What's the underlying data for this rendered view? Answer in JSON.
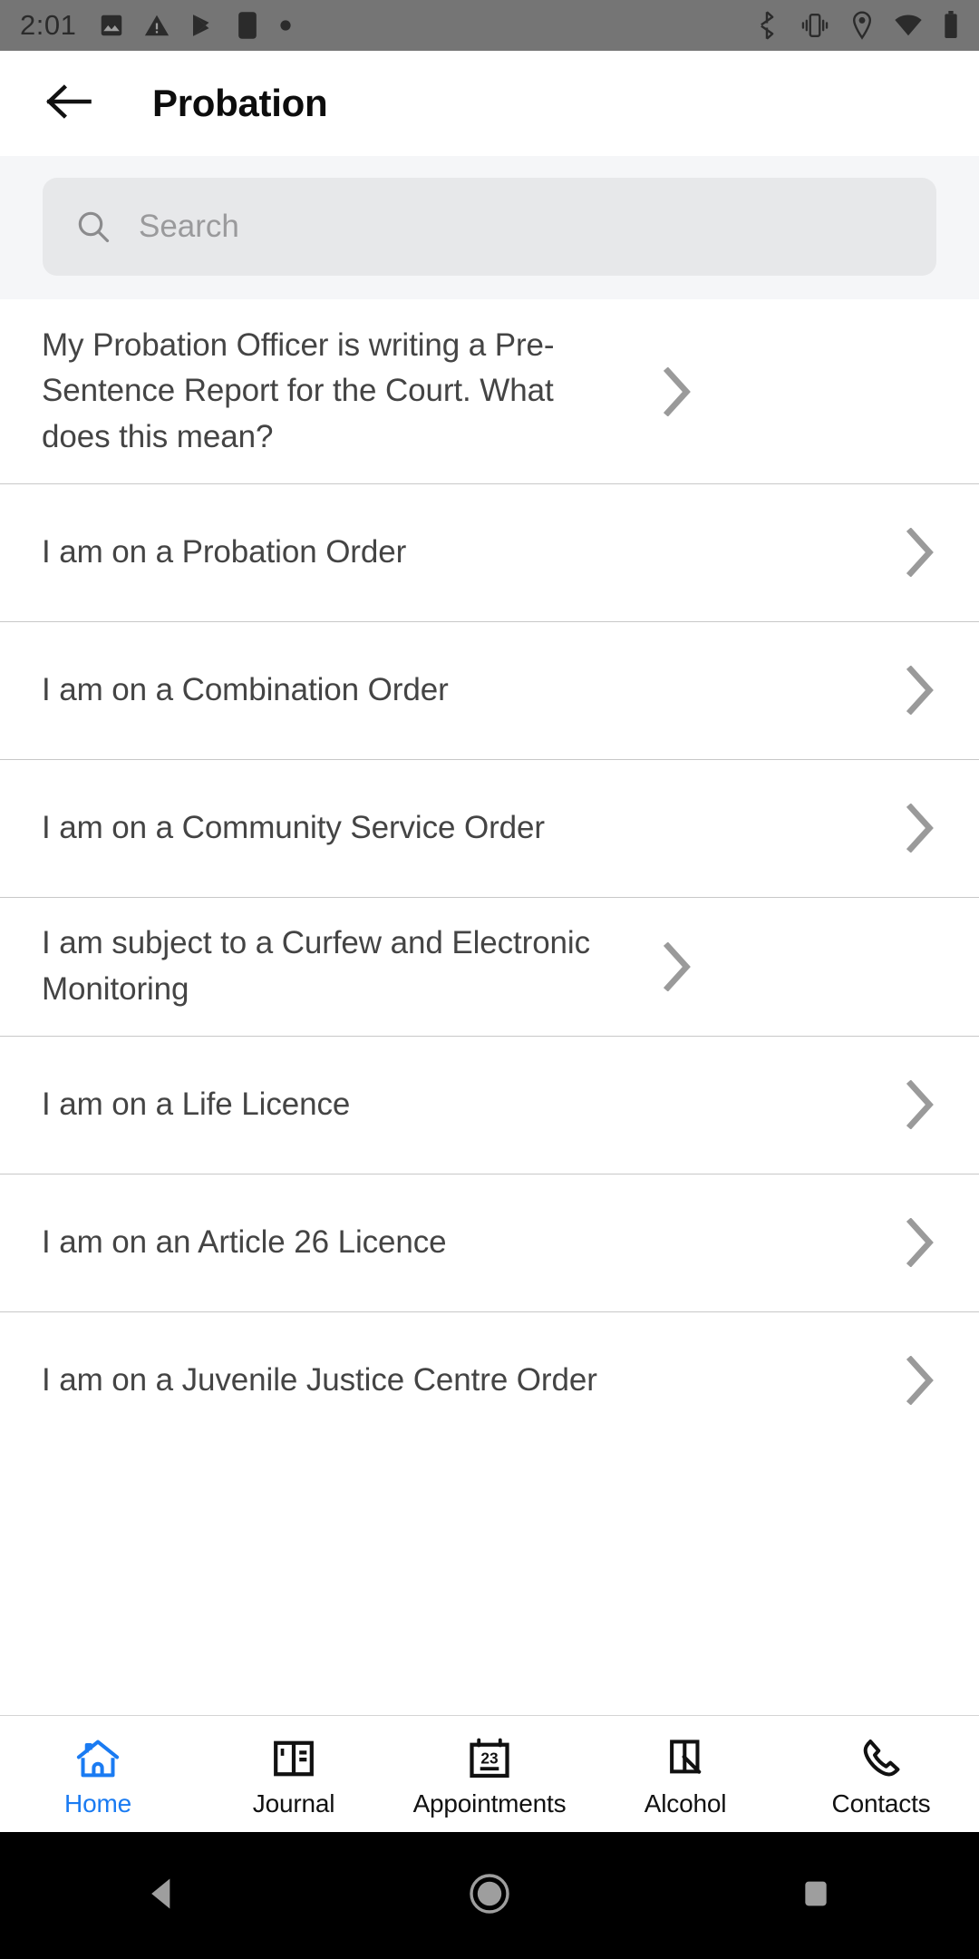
{
  "status_bar": {
    "time": "2:01",
    "left_icons": [
      "image-icon",
      "warning-icon",
      "play-store-icon",
      "app-square-icon",
      "dot-icon"
    ],
    "right_icons": [
      "bluetooth-icon",
      "vibrate-icon",
      "location-icon",
      "wifi-icon",
      "battery-icon"
    ],
    "background_color": "#757575"
  },
  "app_bar": {
    "back_icon": "back-arrow-icon",
    "title": "Probation"
  },
  "search": {
    "icon": "search-icon",
    "placeholder": "Search",
    "value": ""
  },
  "list": {
    "chevron_icon": "chevron-right-icon",
    "items": [
      {
        "label": "My Probation Officer is writing a Pre-Sentence Report for the Court. What does this mean?"
      },
      {
        "label": "I am on a Probation Order"
      },
      {
        "label": "I am on a Combination Order"
      },
      {
        "label": "I am on a Community Service Order"
      },
      {
        "label": "I am subject to a Curfew and Electronic Monitoring"
      },
      {
        "label": "I am on a Life Licence"
      },
      {
        "label": "I am on an Article 26 Licence"
      },
      {
        "label": "I am on a Juvenile Justice Centre Order"
      }
    ]
  },
  "bottom_nav": {
    "active_color": "#1a7bf2",
    "items": [
      {
        "label": "Home",
        "icon": "home-icon",
        "active": true
      },
      {
        "label": "Journal",
        "icon": "journal-book-icon",
        "active": false
      },
      {
        "label": "Appointments",
        "icon": "calendar-23-icon",
        "active": false
      },
      {
        "label": "Alcohol",
        "icon": "alcohol-door-icon",
        "active": false
      },
      {
        "label": "Contacts",
        "icon": "phone-icon",
        "active": false
      }
    ]
  },
  "android_nav": {
    "back": "android-back-icon",
    "home": "android-home-icon",
    "recents": "android-recents-icon"
  }
}
